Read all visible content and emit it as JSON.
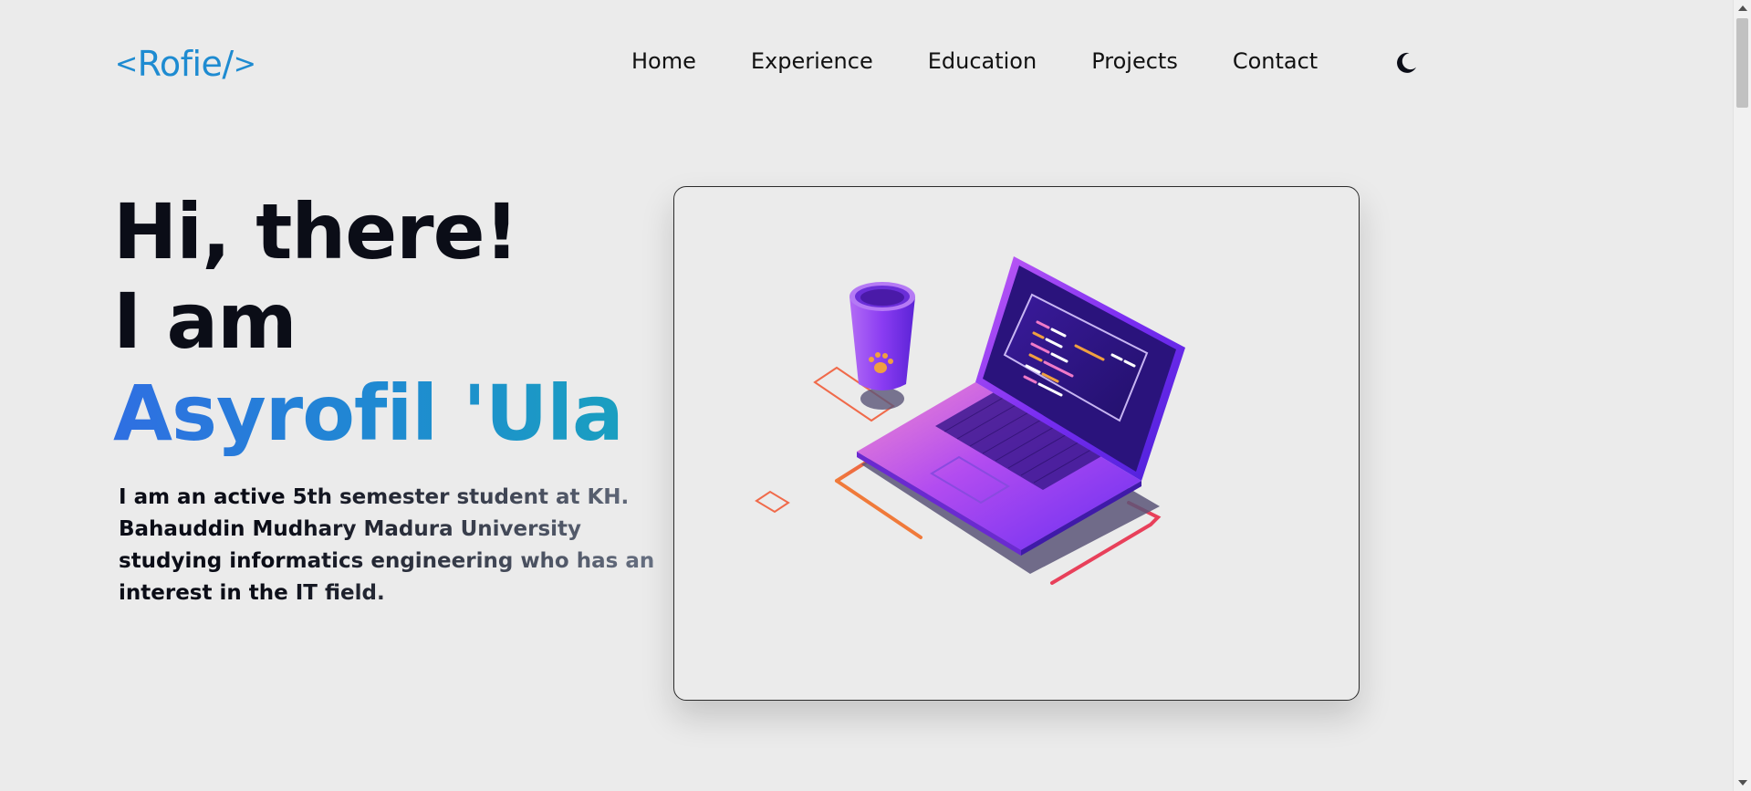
{
  "header": {
    "logo_open": "<",
    "logo_text": "Rofie/",
    "logo_close": ">",
    "nav": {
      "home": "Home",
      "experience": "Experience",
      "education": "Education",
      "projects": "Projects",
      "contact": "Contact"
    },
    "theme_toggle_icon": "moon-icon"
  },
  "hero": {
    "line1": "Hi, there!",
    "line2": "I am",
    "name": "Asyrofil 'Ula",
    "description": "I am an active 5th semester student at KH. Bahauddin Mudhary Madura University studying informatics engineering who has an interest in the IT field."
  },
  "illustration": {
    "icon": "laptop-and-coffee-cup-illustration"
  },
  "colors": {
    "background": "#ebebeb",
    "accent_blue": "#1e8bd1",
    "name_gradient_start": "#2f6fe2",
    "name_gradient_end": "#1a9fc0",
    "laptop_purple": "#7b2ff7"
  }
}
